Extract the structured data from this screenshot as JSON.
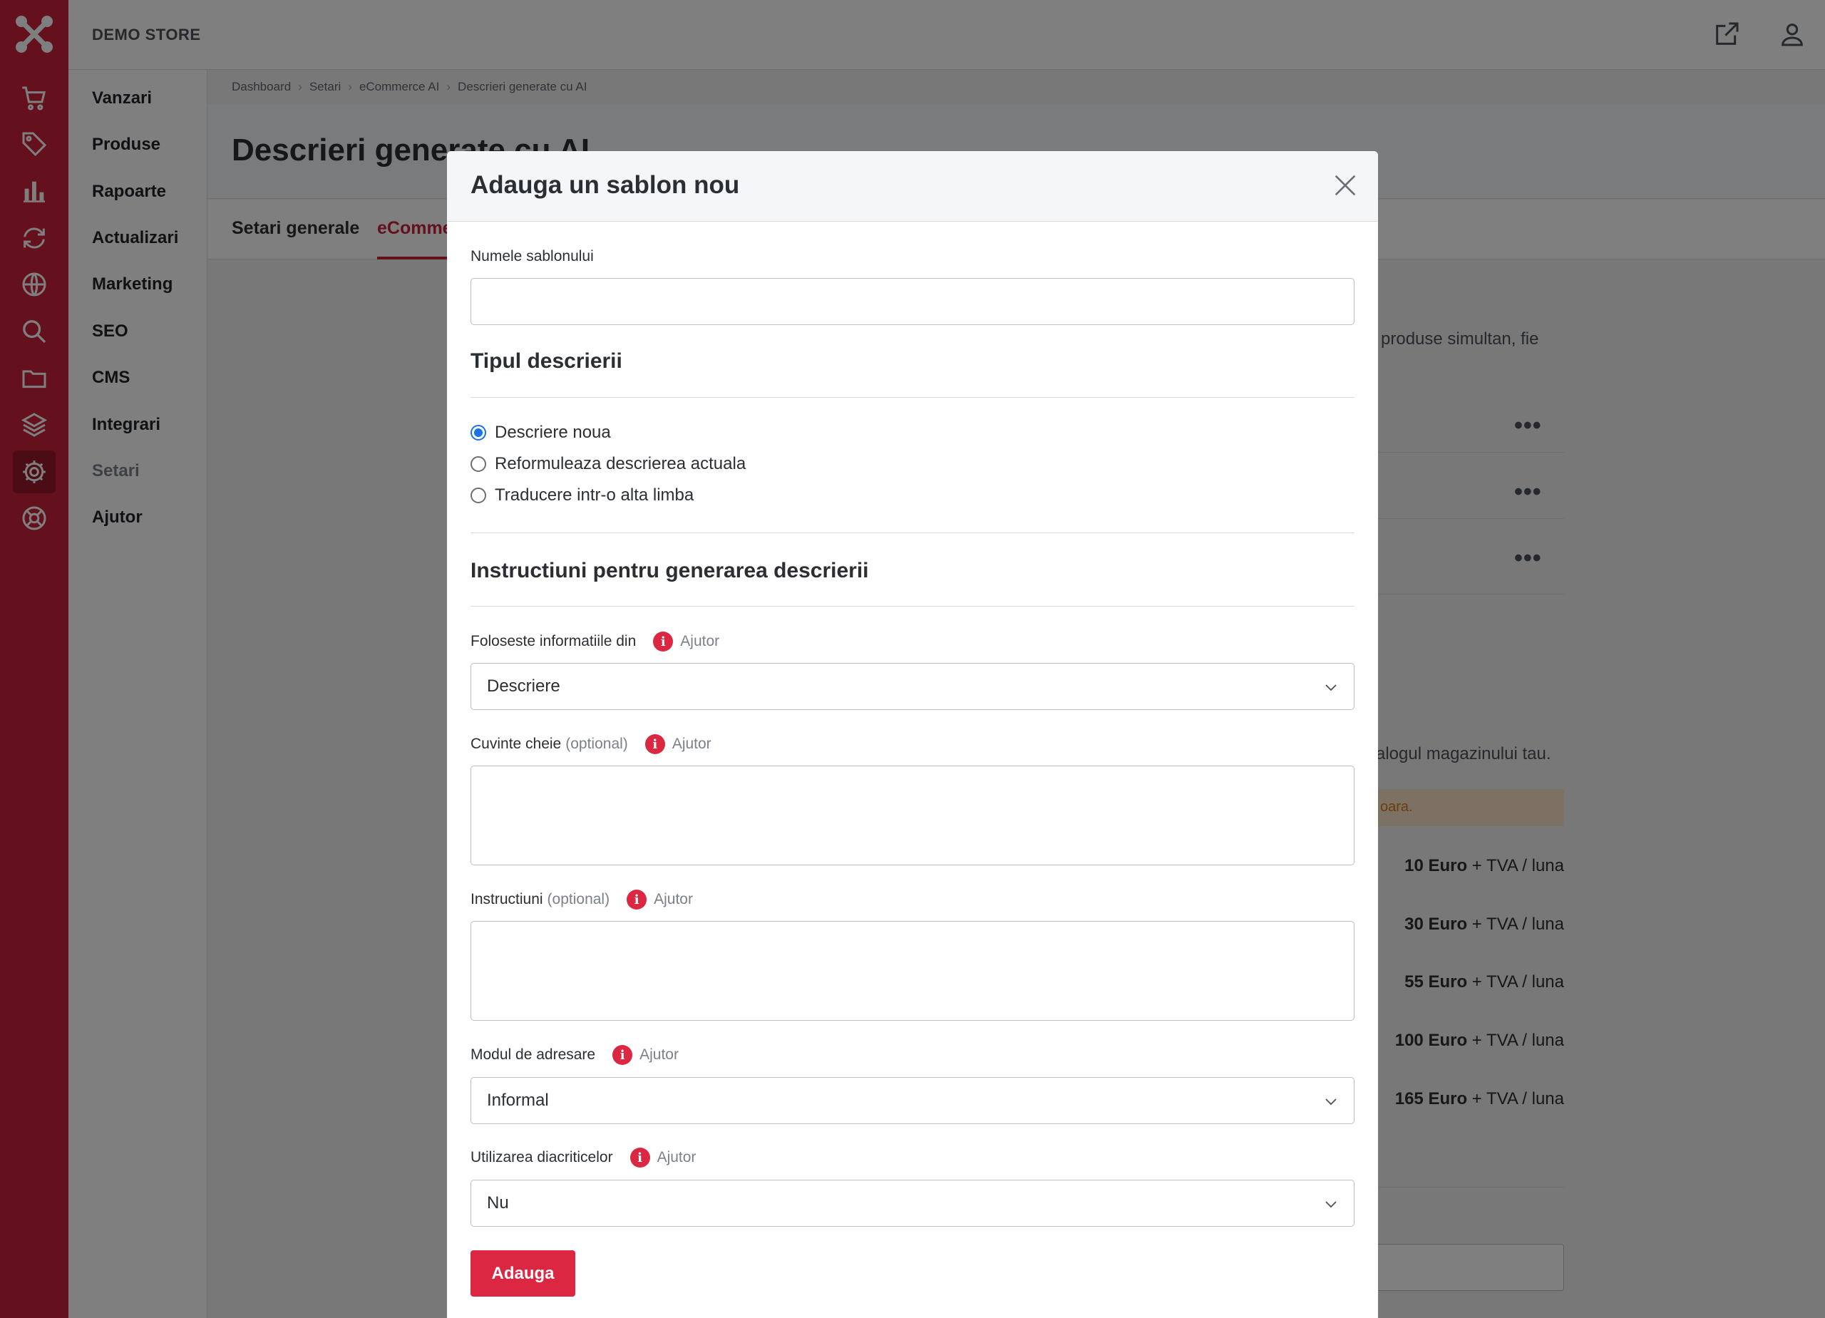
{
  "topbar": {
    "store_name": "DEMO STORE"
  },
  "icons": {
    "rail": [
      "logo-icon",
      "cart-icon",
      "tag-icon",
      "bar-chart-icon",
      "sync-icon",
      "globe-icon",
      "search-icon",
      "folder-icon",
      "layers-icon",
      "gear-icon",
      "help-circle-icon"
    ],
    "topbar": [
      "external-link-icon",
      "user-icon"
    ]
  },
  "colors": {
    "brand": "#c8203a",
    "accent_button": "#dc2743",
    "radio_selected": "#1a73e8"
  },
  "sidebar": {
    "items": [
      {
        "label": "Vanzari"
      },
      {
        "label": "Produse"
      },
      {
        "label": "Rapoarte"
      },
      {
        "label": "Actualizari"
      },
      {
        "label": "Marketing"
      },
      {
        "label": "SEO"
      },
      {
        "label": "CMS"
      },
      {
        "label": "Integrari"
      },
      {
        "label": "Setari"
      },
      {
        "label": "Ajutor"
      }
    ]
  },
  "breadcrumb": [
    "Dashboard",
    "Setari",
    "eCommerce AI",
    "Descrieri generate cu AI"
  ],
  "page": {
    "title": "Descrieri generate cu AI",
    "tabs": [
      "Setari generale",
      "eCommerce AI"
    ]
  },
  "background": {
    "text_line_1": "produse simultan, fie",
    "text_line_2": "alogul magazinului tau.",
    "warning_fragment": "oara.",
    "row_menu": "•••",
    "prices": [
      {
        "amount": "10 Euro",
        "suffix": "+ TVA / luna"
      },
      {
        "amount": "30 Euro",
        "suffix": "+ TVA / luna"
      },
      {
        "amount": "55 Euro",
        "suffix": "+ TVA / luna"
      },
      {
        "amount": "100 Euro",
        "suffix": "+ TVA / luna"
      },
      {
        "amount": "165 Euro",
        "suffix": "+ TVA / luna"
      }
    ]
  },
  "modal": {
    "title": "Adauga un sablon nou",
    "template_name": {
      "label": "Numele sablonului",
      "value": ""
    },
    "description_type": {
      "heading": "Tipul descrierii",
      "options": [
        "Descriere noua",
        "Reformuleaza descrierea actuala",
        "Traducere intr-o alta limba"
      ],
      "selected": "Descriere noua"
    },
    "instructions_section": {
      "heading": "Instructiuni pentru generarea descrierii"
    },
    "help_label": "Ajutor",
    "optional_label": "(optional)",
    "use_info": {
      "label": "Foloseste informatiile din",
      "value": "Descriere"
    },
    "keywords": {
      "label": "Cuvinte cheie",
      "value": ""
    },
    "instructions": {
      "label": "Instructiuni",
      "value": ""
    },
    "addressing": {
      "label": "Modul de adresare",
      "value": "Informal"
    },
    "diacritics": {
      "label": "Utilizarea diacriticelor",
      "value": "Nu"
    },
    "submit_label": "Adauga"
  }
}
